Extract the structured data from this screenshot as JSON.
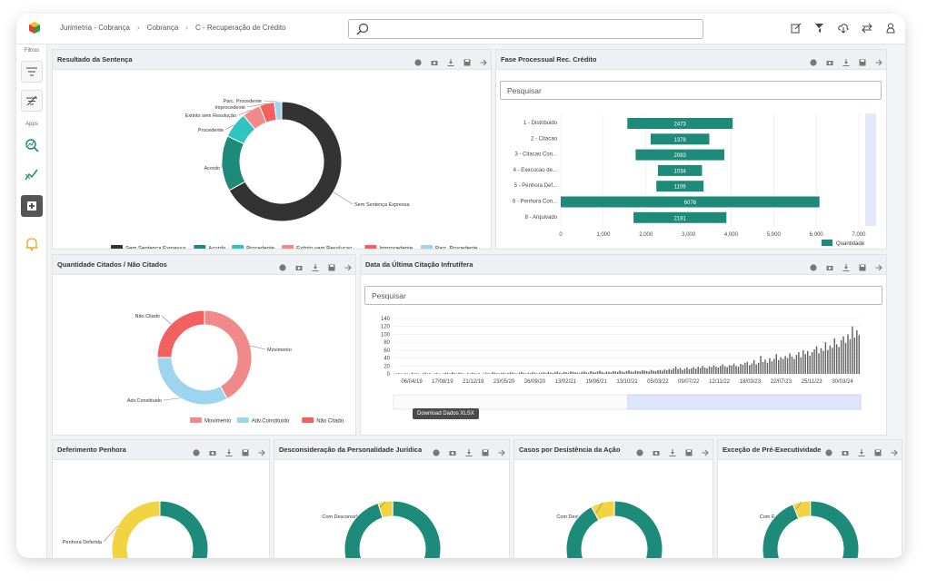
{
  "breadcrumbs": [
    "Jurimetria - Cobrança",
    "Cobrança",
    "C - Recuperação de Crédito"
  ],
  "sidebar": {
    "filtros_label": "Filtros",
    "apps_label": "Apps"
  },
  "colors": {
    "teal": "#1e8a7a",
    "dark": "#333333",
    "cyan": "#2ec4c0",
    "salmon": "#f08a8a",
    "red": "#f26060",
    "lightblue": "#9dd4ee",
    "yellow": "#f2d341"
  },
  "panels": {
    "resultado": {
      "title": "Resultado da Sentença",
      "chart_data": {
        "type": "pie",
        "labels": [
          "Sem Sentença Expressa",
          "Acordo",
          "Procedente",
          "Extinto sem Resolução",
          "Improcedente",
          "Parc. Procedente"
        ],
        "values": [
          67,
          15,
          7,
          5,
          4,
          2
        ],
        "legend": [
          "Sem Sentenca Expressa",
          "Acordo",
          "Procedente",
          "Extinto sem Resolucao",
          "Improcedente",
          "Parc. Procedente"
        ]
      }
    },
    "fase": {
      "title": "Fase Processual Rec. Crédito",
      "search_placeholder": "Pesquisar",
      "chart_data": {
        "type": "bar",
        "categories": [
          "1 - Distribuido",
          "2 - Citacao",
          "3 - Citacao Con...",
          "4 - Execucao de...",
          "5 - Penhora Def...",
          "6 - Penhora Con...",
          "8 - Arquivado"
        ],
        "values": [
          2473,
          1378,
          2083,
          1034,
          1109,
          6076,
          2181
        ],
        "xticks": [
          "0",
          "1,000",
          "2,000",
          "3,000",
          "4,000",
          "5,000",
          "6,000",
          "7,000"
        ],
        "xlim": [
          0,
          7000
        ],
        "legend": "Quantidade"
      }
    },
    "citados": {
      "title": "Quantidade Citados / Não Citados",
      "chart_data": {
        "type": "pie",
        "labels": [
          "Movimento",
          "Adv.Constituido",
          "Não Citado"
        ],
        "values": [
          42,
          33,
          25
        ],
        "legend": [
          "Movimento",
          "Adv.Constituido",
          "Não Citado"
        ]
      }
    },
    "ultima": {
      "title": "Data da Última Citação Infrutífera",
      "search_placeholder": "Pesquisar",
      "chart_data": {
        "type": "bar",
        "yticks": [
          "0",
          "20",
          "40",
          "60",
          "80",
          "100",
          "120",
          "140"
        ],
        "ylim": [
          0,
          140
        ],
        "xticks": [
          "06/04/19",
          "17/08/19",
          "21/12/19",
          "23/05/20",
          "26/09/20",
          "13/02/21",
          "19/06/21",
          "13/10/21",
          "05/03/22",
          "09/07/22",
          "12/11/22",
          "18/03/23",
          "22/07/23",
          "25/11/23",
          "30/03/24"
        ],
        "legend": "Eventos",
        "values": [
          0,
          1,
          2,
          1,
          0,
          2,
          1,
          0,
          3,
          1,
          2,
          1,
          0,
          2,
          3,
          1,
          2,
          0,
          1,
          2,
          1,
          0,
          1,
          3,
          2,
          1,
          4,
          2,
          1,
          3,
          2,
          1,
          0,
          2,
          1,
          3,
          2,
          1,
          2,
          0,
          1,
          3,
          2,
          1,
          4,
          3,
          2,
          1,
          2,
          3,
          1,
          2,
          4,
          3,
          2,
          1,
          3,
          5,
          2,
          1,
          3,
          2,
          4,
          3,
          1,
          2,
          3,
          4,
          2,
          5,
          3,
          2,
          4,
          6,
          3,
          2,
          5,
          4,
          3,
          6,
          5,
          4,
          3,
          2,
          5,
          6,
          4,
          3,
          7,
          5,
          4,
          6,
          8,
          5,
          3,
          6,
          5,
          4,
          7,
          6,
          5,
          8,
          6,
          4,
          7,
          9,
          6,
          5,
          8,
          7,
          6,
          9,
          8,
          7,
          6,
          10,
          8,
          7,
          9,
          10,
          8,
          11,
          9,
          12,
          10,
          14,
          18,
          12,
          15,
          10,
          13,
          16,
          12,
          14,
          17,
          13,
          18,
          15,
          20,
          16,
          14,
          19,
          17,
          22,
          18,
          16,
          20,
          24,
          19,
          17,
          22,
          21,
          26,
          20,
          18,
          25,
          23,
          28,
          30,
          22,
          26,
          35,
          24,
          28,
          45,
          30,
          36,
          28,
          40,
          32,
          38,
          50,
          35,
          42,
          38,
          45,
          40,
          52,
          44,
          38,
          48,
          55,
          42,
          60,
          50,
          58,
          46,
          55,
          62,
          70,
          52,
          65,
          58,
          80,
          60,
          72,
          66,
          90,
          75,
          68,
          85,
          95,
          78,
          100,
          88,
          120,
          92,
          110,
          98
        ]
      }
    },
    "deferimento": {
      "title": "Deferimento Penhora",
      "chart_data": {
        "type": "pie",
        "labels": [
          "Penhora Indef...",
          "Penhora Deferida"
        ],
        "values": [
          66,
          34
        ]
      }
    },
    "desconsideracao": {
      "title": "Desconsideração da Personalidade Jurídica",
      "tooltip": "Download Dados XLSX",
      "chart_data": {
        "type": "pie",
        "labels": [
          "Com Desconsideração",
          "Sem"
        ],
        "values": [
          5,
          95
        ]
      }
    },
    "desistencia": {
      "title": "Casos por Desistência da Ação",
      "chart_data": {
        "type": "pie",
        "labels": [
          "Com Desistência",
          "Sem"
        ],
        "values": [
          8,
          92
        ]
      }
    },
    "excecao": {
      "title": "Exceção de Pré-Executividade",
      "chart_data": {
        "type": "pie",
        "labels": [
          "Com Exceção",
          "Sem"
        ],
        "values": [
          6,
          94
        ]
      }
    }
  }
}
